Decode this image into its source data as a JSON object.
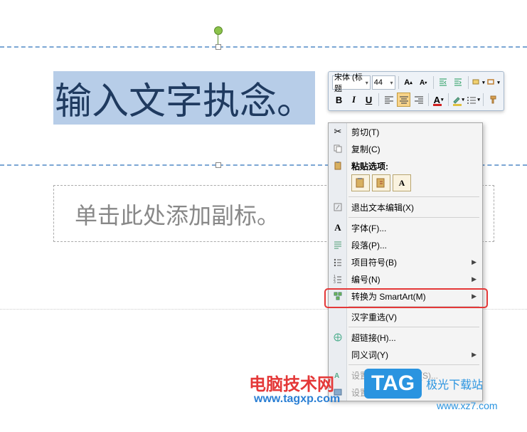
{
  "slide": {
    "title_text": "输入文字执念。",
    "subtitle_placeholder": "单击此处添加副标。"
  },
  "mini_toolbar": {
    "font_name": "宋体 (标题",
    "font_size": "44",
    "bold": "B",
    "italic": "I",
    "underline": "U"
  },
  "context_menu": {
    "cut": "剪切(T)",
    "copy": "复制(C)",
    "paste_header": "粘贴选项:",
    "exit_text": "退出文本编辑(X)",
    "font": "字体(F)...",
    "paragraph": "段落(P)...",
    "bullets": "项目符号(B)",
    "numbering": "编号(N)",
    "convert_smartart": "转换为 SmartArt(M)",
    "hanzi": "汉字重选(V)",
    "hyperlink": "超链接(H)...",
    "synonyms": "同义词(Y)",
    "set_text_effect": "设置文字效果格式(S)...",
    "set_shape_format": "设置形状格式(O)..."
  },
  "watermarks": {
    "wm1_title": "电脑技术网",
    "wm1_url": "www.tagxp.com",
    "wm2_tag": "TAG",
    "wm2_text": "极光下载站",
    "wm2_url": "www.xz7.com"
  }
}
